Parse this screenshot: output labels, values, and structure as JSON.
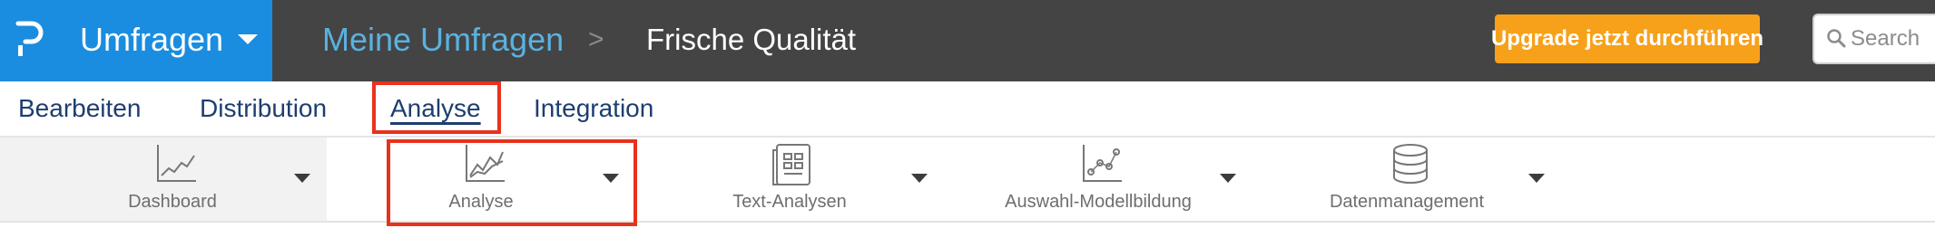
{
  "colors": {
    "brand_blue": "#1a8de0",
    "header_bg": "#444444",
    "breadcrumb_link": "#5ab2e0",
    "upgrade_orange": "#f7a11a",
    "nav_text": "#1d3e70",
    "highlight_red": "#e8321d"
  },
  "header": {
    "logo_icon": "brand-p-logo",
    "product": "Umfragen",
    "breadcrumb": {
      "root": "Meine Umfragen",
      "separator": ">",
      "current": "Frische Qualität"
    },
    "upgrade_label": "Upgrade jetzt durchführen",
    "search": {
      "placeholder": "Search",
      "icon": "search-icon"
    }
  },
  "nav": {
    "tabs": [
      {
        "label": "Bearbeiten",
        "active": false
      },
      {
        "label": "Distribution",
        "active": false
      },
      {
        "label": "Analyse",
        "active": true,
        "highlighted": true
      },
      {
        "label": "Integration",
        "active": false
      }
    ]
  },
  "toolbar": {
    "tools": [
      {
        "label": "Dashboard",
        "icon": "line-chart-icon",
        "selected": true
      },
      {
        "label": "Analyse",
        "icon": "multi-line-chart-icon",
        "highlighted": true
      },
      {
        "label": "Text-Analysen",
        "icon": "text-document-icon"
      },
      {
        "label": "Auswahl-Modellbildung",
        "icon": "scatter-chart-icon"
      },
      {
        "label": "Datenmanagement",
        "icon": "database-icon"
      }
    ]
  }
}
